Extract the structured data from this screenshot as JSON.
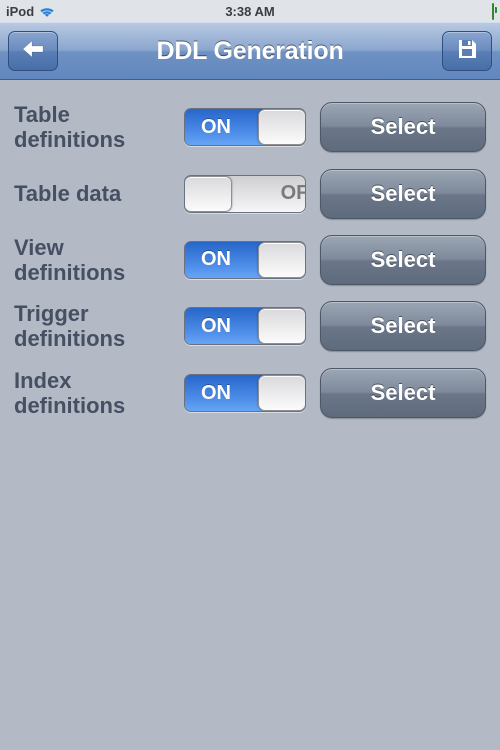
{
  "statusbar": {
    "device": "iPod",
    "time": "3:38 AM"
  },
  "nav": {
    "title": "DDL Generation"
  },
  "toggle_text": {
    "on": "ON",
    "off": "OFF"
  },
  "select_label": "Select",
  "options": [
    {
      "label": "Table definitions",
      "state": "ON"
    },
    {
      "label": "Table data",
      "state": "OFF"
    },
    {
      "label": "View definitions",
      "state": "ON"
    },
    {
      "label": "Trigger definitions",
      "state": "ON"
    },
    {
      "label": "Index definitions",
      "state": "ON"
    }
  ]
}
